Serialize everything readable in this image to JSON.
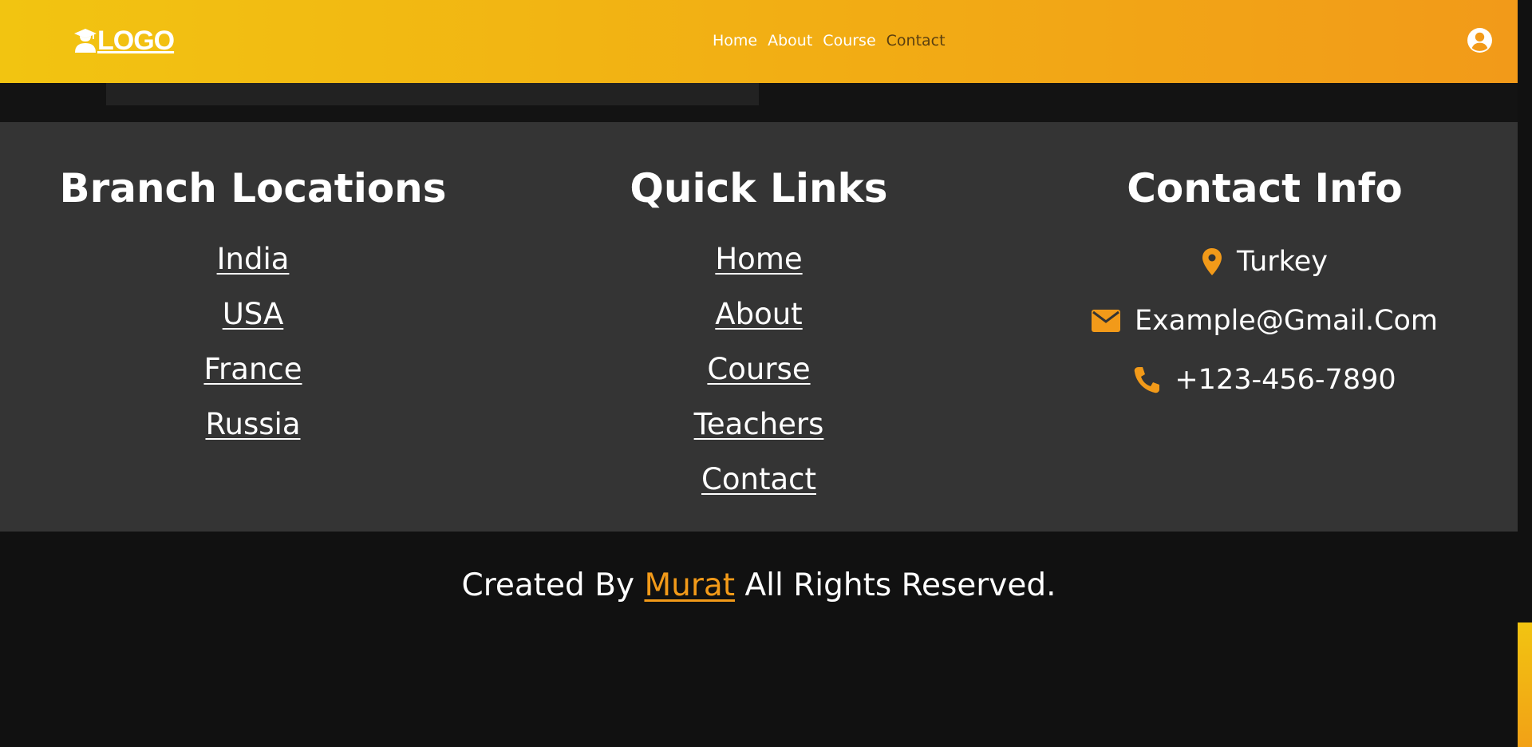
{
  "header": {
    "logo_text": "LOGO",
    "nav": [
      "Home",
      "About",
      "Course",
      "Contact"
    ]
  },
  "footer": {
    "branch": {
      "title": "Branch Locations",
      "items": [
        "India",
        "USA",
        "France",
        "Russia"
      ]
    },
    "quick_links": {
      "title": "Quick Links",
      "items": [
        "Home",
        "About",
        "Course",
        "Teachers",
        "Contact"
      ]
    },
    "contact": {
      "title": "Contact Info",
      "location": "Turkey",
      "email": "Example@Gmail.Com",
      "phone": "+123-456-7890"
    }
  },
  "bottom": {
    "prefix": "Created By",
    "author": "Murat",
    "suffix": "All Rights Reserved."
  },
  "colors": {
    "accent": "#f29a19",
    "header_start": "#f2c411",
    "footer_bg": "#343434",
    "page_bg": "#111111"
  }
}
